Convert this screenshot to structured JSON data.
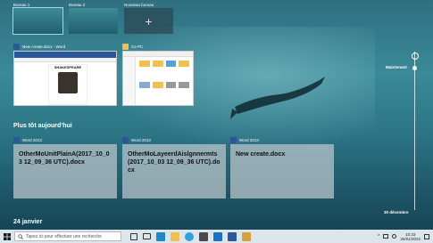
{
  "desktops": {
    "items": [
      {
        "label": "Bureau 1",
        "active": true
      },
      {
        "label": "Bureau 2",
        "active": false
      }
    ],
    "new_label": "Nouveau bureau",
    "add_glyph": "+"
  },
  "open_windows": [
    {
      "title": "New create.docx - Word",
      "icon": "word-icon"
    },
    {
      "title": "Ce PC",
      "icon": "file-explorer-icon"
    }
  ],
  "doc_preview": {
    "heading": "SHAKESPEARE"
  },
  "timeline": {
    "heading_today": "Plus tôt aujourd’hui",
    "heading_date": "24 janvier",
    "now_label": "Maintenant",
    "date_label": "30 décembre",
    "activities": [
      {
        "app": "Word 2013",
        "title": "OtherMoUnitPlainA(2017_10_03 12_09_36 UTC).docx"
      },
      {
        "app": "Word 2013",
        "title": "OtherMoLayeerdAislgnnermts(2017_10_03 12_09_36 UTC).docx"
      },
      {
        "app": "Word 2013",
        "title": "New create.docx"
      }
    ]
  },
  "taskbar": {
    "search_placeholder": "Tapez ici pour effectuer une recherche",
    "time": "10:33",
    "date": "26/01/2022",
    "pinned_icons": [
      "task-view-icon",
      "file-explorer-icon",
      "edge-icon",
      "store-icon",
      "mail-icon",
      "word-icon",
      "photos-icon"
    ]
  },
  "colors": {
    "word": "#2b579a",
    "taskbar": "#dce5ea",
    "card": "#bec8cd"
  }
}
